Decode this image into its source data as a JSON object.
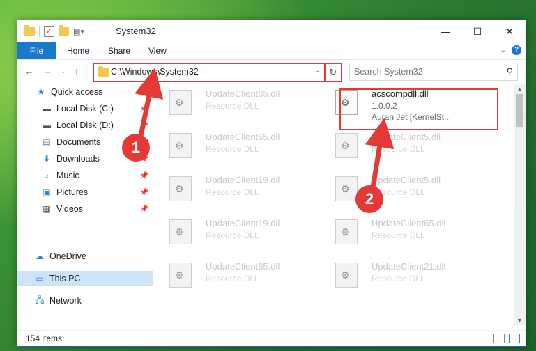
{
  "window": {
    "title": "System32"
  },
  "ribbon": {
    "tabs": [
      "File",
      "Home",
      "Share",
      "View"
    ]
  },
  "address": {
    "path": "C:\\Windows\\System32"
  },
  "search": {
    "placeholder": "Search System32"
  },
  "sidebar": {
    "items": [
      {
        "label": "Quick access",
        "icon": "star-icon"
      },
      {
        "label": "Local Disk (C:)",
        "icon": "drive-icon"
      },
      {
        "label": "Local Disk (D:)",
        "icon": "drive-icon"
      },
      {
        "label": "Documents",
        "icon": "documents-icon"
      },
      {
        "label": "Downloads",
        "icon": "download-icon"
      },
      {
        "label": "Music",
        "icon": "music-icon"
      },
      {
        "label": "Pictures",
        "icon": "pictures-icon"
      },
      {
        "label": "Videos",
        "icon": "videos-icon"
      },
      {
        "label": "OneDrive",
        "icon": "cloud-icon"
      },
      {
        "label": "This PC",
        "icon": "computer-icon"
      },
      {
        "label": "Network",
        "icon": "network-icon"
      }
    ]
  },
  "files": [
    {
      "name": "UpdateClient65.dll",
      "type": "Resource DLL"
    },
    {
      "name": "acscompdll.dll",
      "version": "1.0.0.2",
      "company": "Auran Jet [KernelSt..."
    },
    {
      "name": "UpdateClient65.dll",
      "type": "Resource DLL"
    },
    {
      "name": "UpdateClient5.dll",
      "type": "Resource DLL"
    },
    {
      "name": "UpdateClient19.dll",
      "type": "Resource DLL"
    },
    {
      "name": "UpdateClient5.dll",
      "type": "Resource DLL"
    },
    {
      "name": "UpdateClient19.dll",
      "type": "Resource DLL"
    },
    {
      "name": "UpdateClient65.dll",
      "type": "Resource DLL"
    },
    {
      "name": "UpdateClient65.dll",
      "type": "Resource DLL"
    },
    {
      "name": "UpdateClient21.dll",
      "type": "Resource DLL"
    }
  ],
  "status": {
    "item_count": "154 items"
  },
  "annotations": {
    "step1": "1",
    "step2": "2"
  },
  "colors": {
    "accent": "#1979ca",
    "highlight": "#e53935",
    "selected": "#cce4f7"
  }
}
